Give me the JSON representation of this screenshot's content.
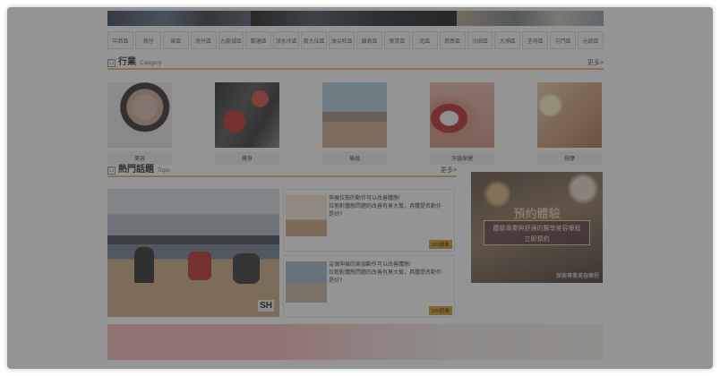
{
  "districts": [
    "中西區",
    "灣仔",
    "東區",
    "灣仔區",
    "九龍城區",
    "觀塘區",
    "深水埗區",
    "黃大仙區",
    "油尖旺區",
    "離島區",
    "葵青區",
    "北區",
    "西貢區",
    "沙田區",
    "大埔區",
    "荃灣區",
    "屯門區",
    "元朗區"
  ],
  "category_section": {
    "title": "行業",
    "subtitle": "Category",
    "more": "更多>"
  },
  "categories": [
    {
      "label": "美容",
      "icon": "beauty-photo"
    },
    {
      "label": "健身",
      "icon": "fitness-photo"
    },
    {
      "label": "瑜珈",
      "icon": "yoga-photo"
    },
    {
      "label": "牙齒保健",
      "icon": "dental-photo"
    },
    {
      "label": "按摩",
      "icon": "massage-photo"
    }
  ],
  "topic_section": {
    "title": "熱門話題",
    "subtitle": "Topic",
    "more": "更多>"
  },
  "topics": [
    {
      "text": "伸展拉筋的動作可以改善體態! 拉筋對體態問題的改善有莫大的幫助，為大家介紹可以改善體態的拉筋動作，一同來學習吧！",
      "line1": "伸展拉筋的動作可以改善體態!",
      "line2": "拉筋對體態問題的改善有莫大幫，具體提名動作",
      "line3": "是好?",
      "badge": "100觀看"
    },
    {
      "text": "",
      "line1": "這個伸展的瑜伽動作可以改善體態!",
      "line2": "拉筋對體態問題的改善有莫大幫，具體提名動作",
      "line3": "是好?",
      "badge": "100觀看"
    }
  ],
  "ad": {
    "title": "預約體驗",
    "line1": "體驗專業與舒適的醫學美容療程",
    "line2": "立即預約",
    "caption": "探索專業美容療程"
  },
  "big_logo": "SH"
}
